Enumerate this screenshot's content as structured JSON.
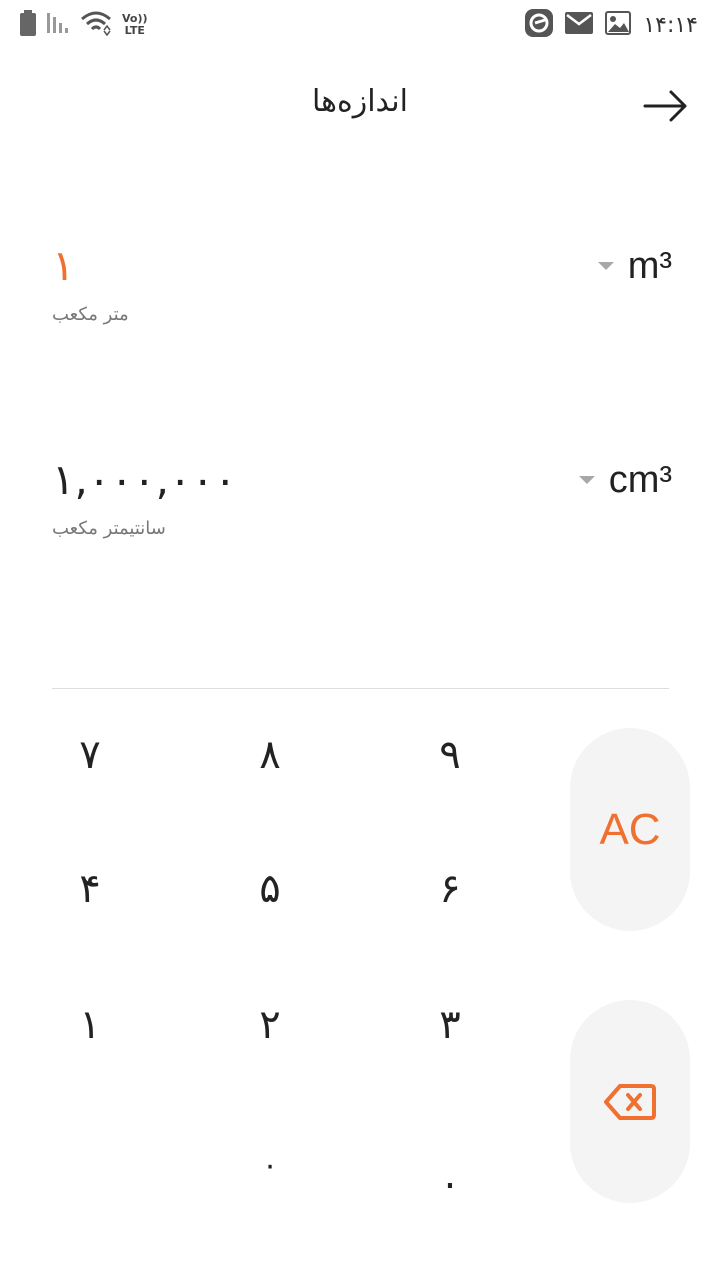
{
  "status_bar": {
    "time": "۱۴:۱۴",
    "network_label_top": "Vo))",
    "network_label_bottom": "LTE"
  },
  "header": {
    "title": "اندازه‌ها",
    "back_icon": "arrow-right-icon"
  },
  "converter": {
    "from": {
      "value": "۱",
      "symbol": "m³",
      "name": "متر مکعب"
    },
    "to": {
      "value": "۱,۰۰۰,۰۰۰",
      "symbol": "cm³",
      "name": "سانتیمتر مکعب"
    }
  },
  "keypad": {
    "keys": [
      "۷",
      "۸",
      "۹",
      "۴",
      "۵",
      "۶",
      "۱",
      "۲",
      "۳",
      "۰",
      "."
    ],
    "clear_label": "AC",
    "backspace_icon": "backspace-icon"
  },
  "colors": {
    "accent": "#f07030",
    "side_key_bg": "#f4f4f4",
    "divider": "#dedede"
  }
}
